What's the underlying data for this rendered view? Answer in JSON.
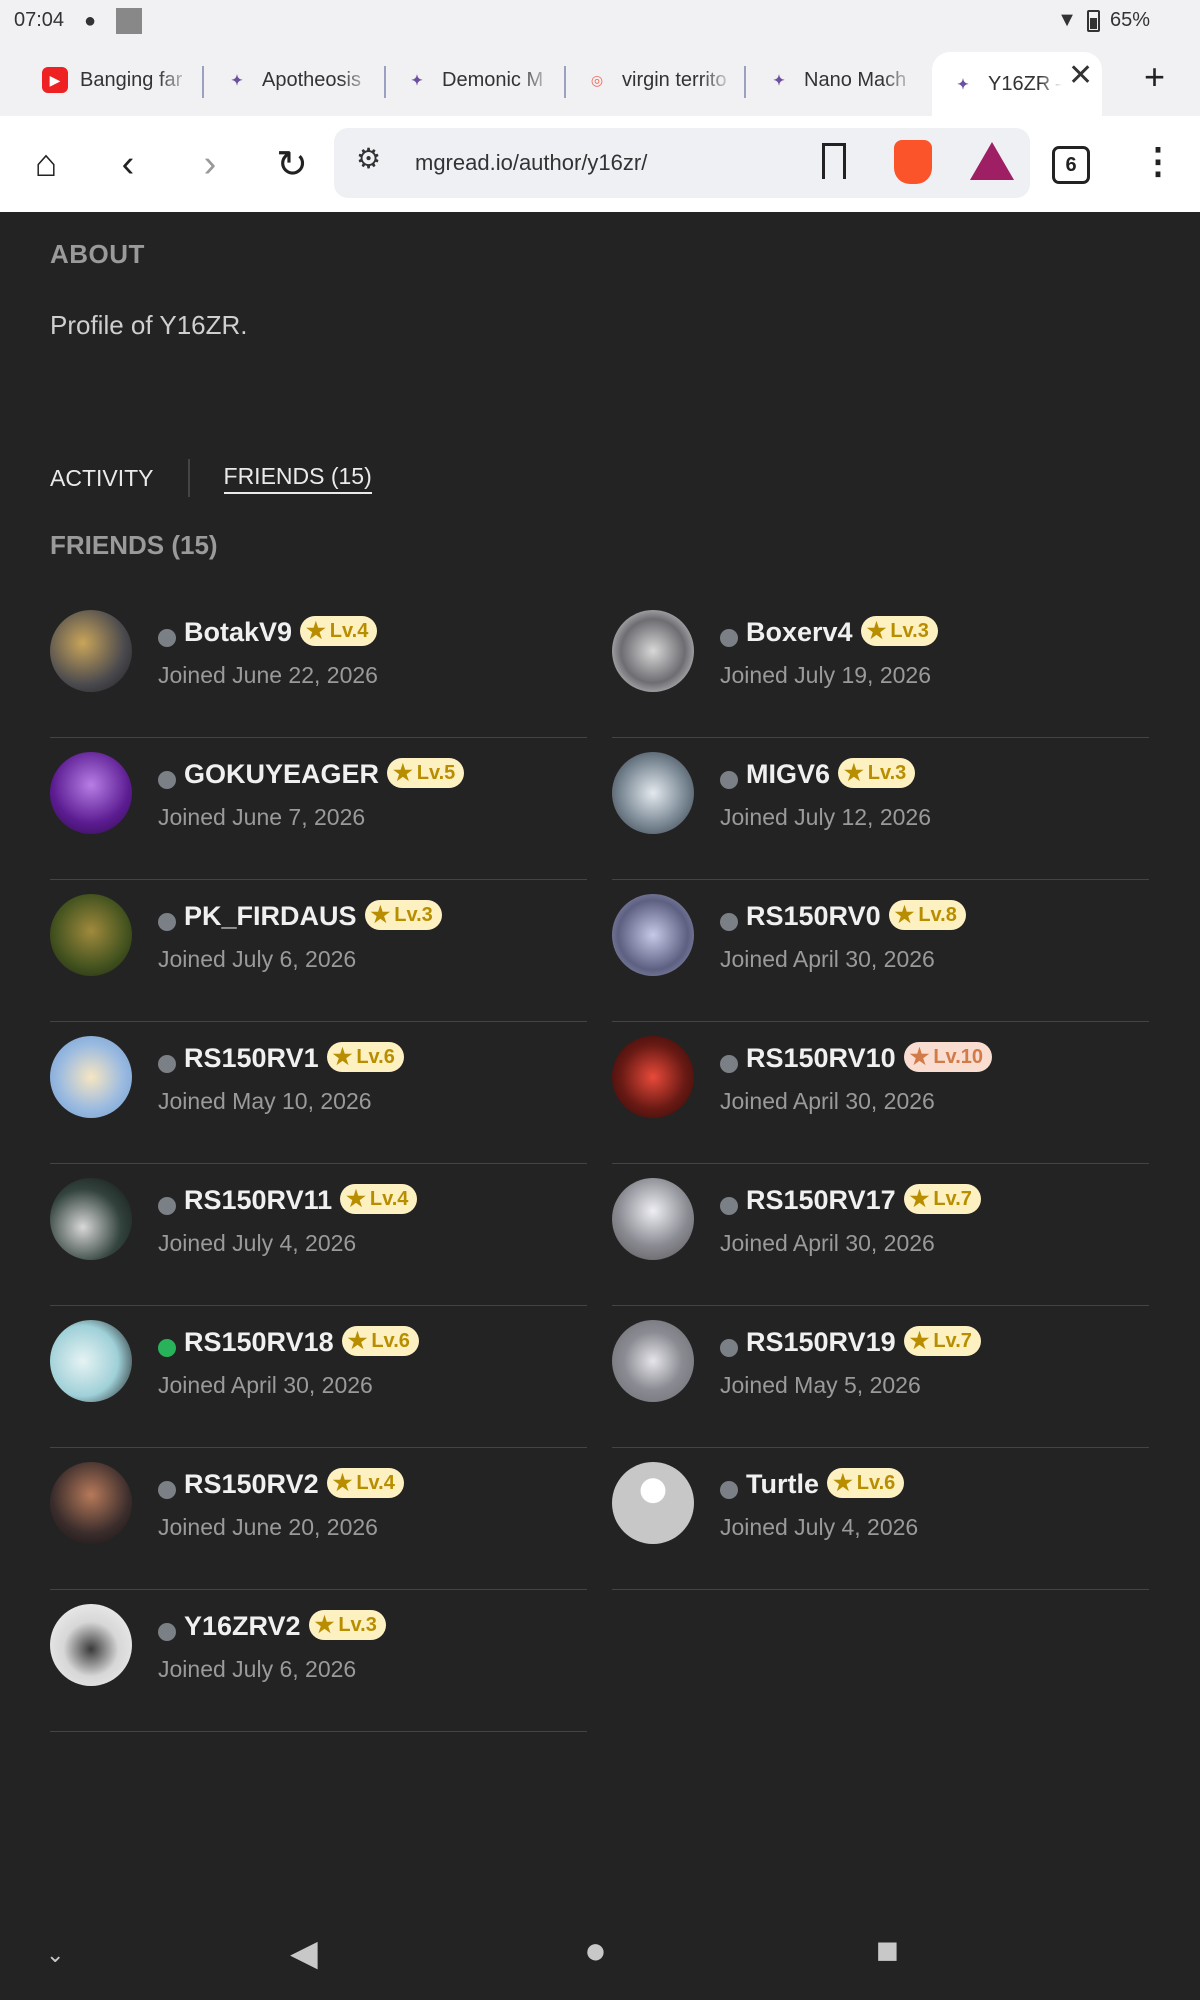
{
  "status": {
    "time": "07:04",
    "battery": "65%"
  },
  "tabs": [
    {
      "title": "Banging far",
      "favicon": "youtube-icon"
    },
    {
      "title": "Apotheosis",
      "favicon": "mgread-icon"
    },
    {
      "title": "Demonic M",
      "favicon": "mgread-icon"
    },
    {
      "title": "virgin territo",
      "favicon": "brave-shield-icon"
    },
    {
      "title": "Nano Mach",
      "favicon": "mgread-icon"
    },
    {
      "title": "Y16ZR –",
      "favicon": "mgread-icon",
      "active": true
    }
  ],
  "toolbar": {
    "url": "mgread.io/author/y16zr/",
    "tab_count": "6"
  },
  "about": {
    "heading": "ABOUT",
    "text": "Profile of Y16ZR."
  },
  "profile_tabs": {
    "activity": "ACTIVITY",
    "friends": "FRIENDS (15)"
  },
  "friends_heading": "FRIENDS (15)",
  "friends": [
    {
      "name": "BotakV9",
      "level": "Lv.4",
      "joined": "Joined June 22, 2026",
      "online": false
    },
    {
      "name": "Boxerv4",
      "level": "Lv.3",
      "joined": "Joined July 19, 2026",
      "online": false
    },
    {
      "name": "GOKUYEAGER",
      "level": "Lv.5",
      "joined": "Joined June 7, 2026",
      "online": false
    },
    {
      "name": "MIGV6",
      "level": "Lv.3",
      "joined": "Joined July 12, 2026",
      "online": false
    },
    {
      "name": "PK_FIRDAUS",
      "level": "Lv.3",
      "joined": "Joined July 6, 2026",
      "online": false
    },
    {
      "name": "RS150RV0",
      "level": "Lv.8",
      "joined": "Joined April 30, 2026",
      "online": false
    },
    {
      "name": "RS150RV1",
      "level": "Lv.6",
      "joined": "Joined May 10, 2026",
      "online": false
    },
    {
      "name": "RS150RV10",
      "level": "Lv.10",
      "joined": "Joined April 30, 2026",
      "online": false
    },
    {
      "name": "RS150RV11",
      "level": "Lv.4",
      "joined": "Joined July 4, 2026",
      "online": false
    },
    {
      "name": "RS150RV17",
      "level": "Lv.7",
      "joined": "Joined April 30, 2026",
      "online": false
    },
    {
      "name": "RS150RV18",
      "level": "Lv.6",
      "joined": "Joined April 30, 2026",
      "online": true
    },
    {
      "name": "RS150RV19",
      "level": "Lv.7",
      "joined": "Joined May 5, 2026",
      "online": false
    },
    {
      "name": "RS150RV2",
      "level": "Lv.4",
      "joined": "Joined June 20, 2026",
      "online": false
    },
    {
      "name": "Turtle",
      "level": "Lv.6",
      "joined": "Joined July 4, 2026",
      "online": false
    },
    {
      "name": "Y16ZRV2",
      "level": "Lv.3",
      "joined": "Joined July 6, 2026",
      "online": false
    }
  ],
  "colors": {
    "page_bg": "#232323",
    "level_badge_bg": "#fdf0c1",
    "level_badge_text": "#b88e00",
    "online": "#28b35a",
    "offline": "#7b8087"
  }
}
